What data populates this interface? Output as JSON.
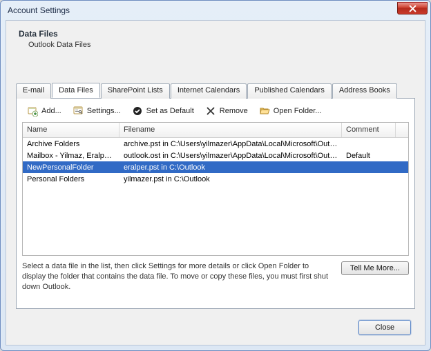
{
  "window": {
    "title": "Account Settings"
  },
  "header": {
    "title": "Data Files",
    "subtitle": "Outlook Data Files"
  },
  "tabs": [
    {
      "label": "E-mail",
      "active": false
    },
    {
      "label": "Data Files",
      "active": true
    },
    {
      "label": "SharePoint Lists",
      "active": false
    },
    {
      "label": "Internet Calendars",
      "active": false
    },
    {
      "label": "Published Calendars",
      "active": false
    },
    {
      "label": "Address Books",
      "active": false
    }
  ],
  "toolbar": {
    "add": "Add...",
    "settings": "Settings...",
    "set_default": "Set as Default",
    "remove": "Remove",
    "open_folder": "Open Folder..."
  },
  "list": {
    "columns": {
      "name": "Name",
      "filename": "Filename",
      "comment": "Comment"
    },
    "rows": [
      {
        "name": "Archive Folders",
        "filename": "archive.pst in C:\\Users\\yilmazer\\AppData\\Local\\Microsoft\\Outlook",
        "comment": "",
        "selected": false
      },
      {
        "name": "Mailbox - Yilmaz, Eralper ...",
        "filename": "outlook.ost in C:\\Users\\yilmazer\\AppData\\Local\\Microsoft\\Outlook",
        "comment": "Default",
        "selected": false
      },
      {
        "name": "NewPersonalFolder",
        "filename": "eralper.pst in C:\\Outlook",
        "comment": "",
        "selected": true
      },
      {
        "name": "Personal Folders",
        "filename": "yilmazer.pst in C:\\Outlook",
        "comment": "",
        "selected": false
      }
    ]
  },
  "hint": {
    "text": "Select a data file in the list, then click Settings for more details or click Open Folder to display the folder that contains the data file. To move or copy these files, you must first shut down Outlook.",
    "button": "Tell Me More..."
  },
  "footer": {
    "close": "Close"
  }
}
